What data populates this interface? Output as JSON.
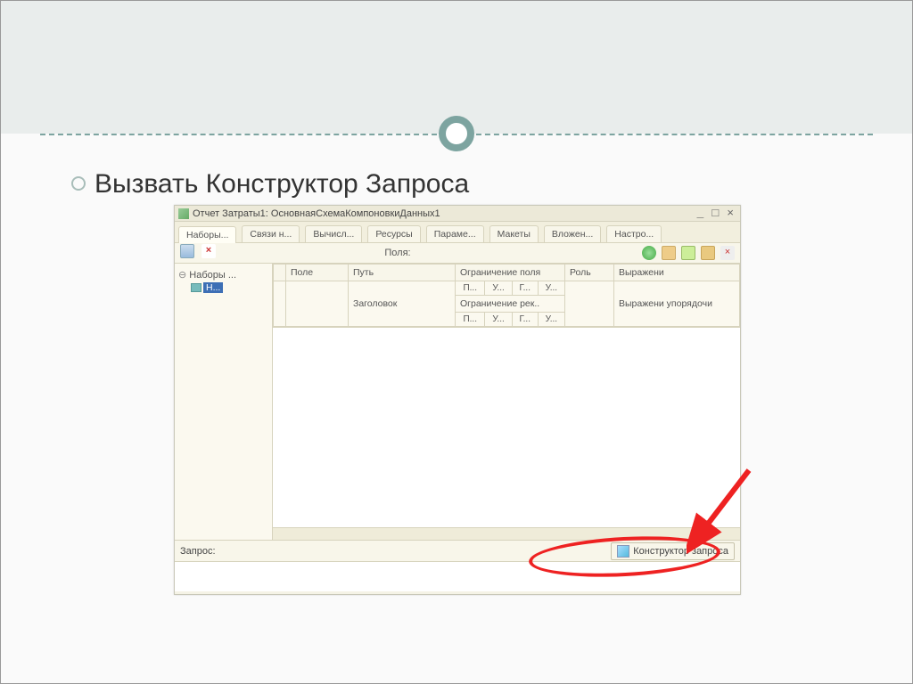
{
  "slide": {
    "bullet_text": "Вызвать Конструктор Запроса"
  },
  "window": {
    "title": "Отчет Затраты1: ОсновнаяСхемаКомпоновкиДанных1",
    "btn_min": "_",
    "btn_max": "□",
    "btn_close": "×"
  },
  "tabs": [
    "Наборы...",
    "Связи н...",
    "Вычисл...",
    "Ресурсы",
    "Параме...",
    "Макеты",
    "Вложен...",
    "Настро..."
  ],
  "fields_label": "Поля:",
  "tree": {
    "root": "Наборы ...",
    "item": "Н..."
  },
  "grid": {
    "h_field": "Поле",
    "h_path": "Путь",
    "h_restrict_field": "Ограничение поля",
    "h_role": "Роль",
    "h_expr": "Выражени",
    "sub_title": "Заголовок",
    "sub_restrict_rec": "Ограничение рек..",
    "sub_expr_order": "Выражени упорядочи",
    "m_p": "П...",
    "m_u": "У...",
    "m_g": "Г..."
  },
  "query": {
    "label": "Запрос:",
    "button": "Конструктор запроса"
  }
}
